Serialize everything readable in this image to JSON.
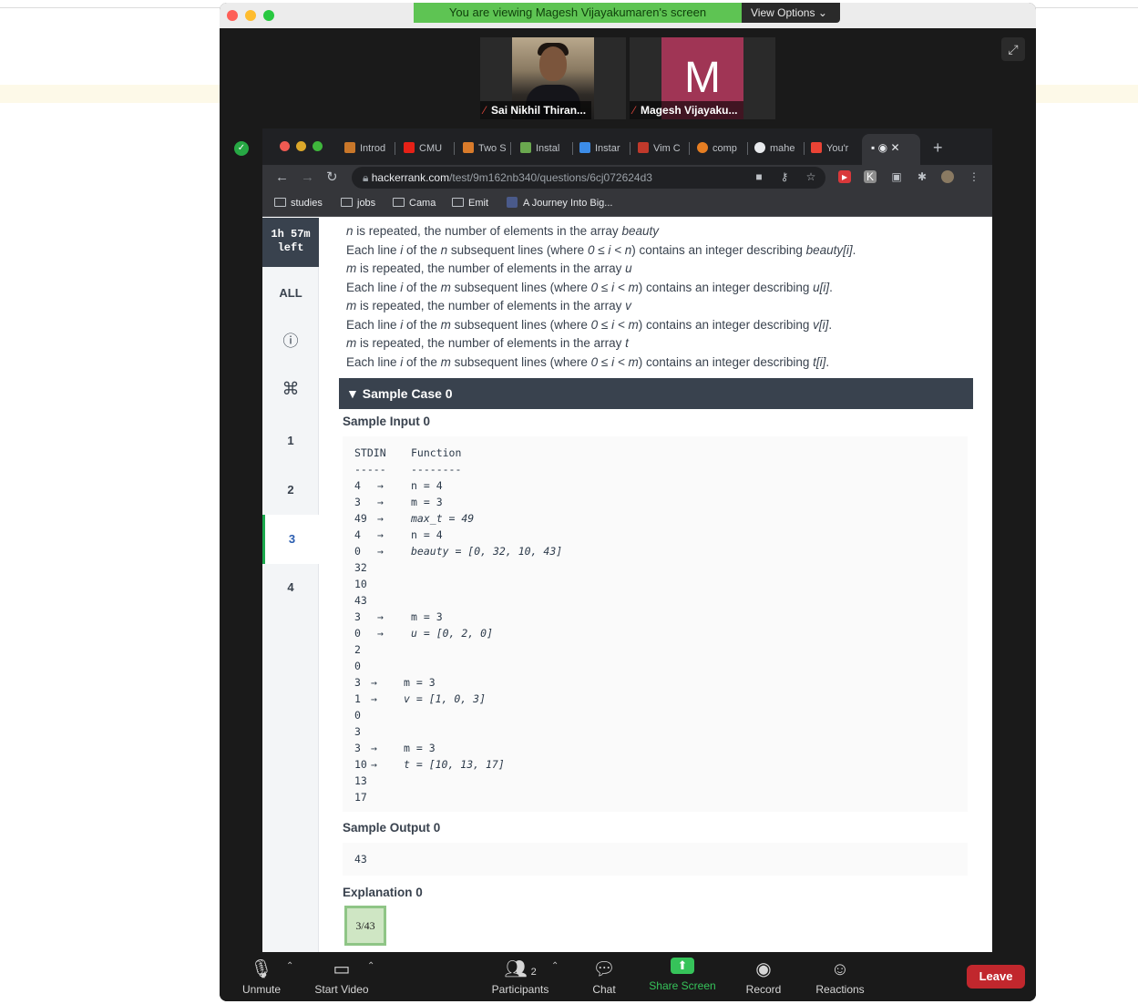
{
  "banner": {
    "viewing": "You are viewing Magesh Vijayakumaren's screen",
    "view_options": "View Options"
  },
  "participants": [
    {
      "name": "Sai Nikhil Thiran...",
      "muted": true
    },
    {
      "name": "Magesh Vijayaku...",
      "initial": "M",
      "muted": true
    }
  ],
  "browser": {
    "tabs": [
      {
        "label": "Introd"
      },
      {
        "label": "CMU"
      },
      {
        "label": "Two S"
      },
      {
        "label": "Instal"
      },
      {
        "label": "Instar"
      },
      {
        "label": "Vim C"
      },
      {
        "label": "comp"
      },
      {
        "label": "mahe"
      },
      {
        "label": "You'r"
      }
    ],
    "url_host": "hackerrank.com",
    "url_path": "/test/9m162nb340/questions/6cj072624d3",
    "bookmarks": [
      "studies",
      "jobs",
      "Cama",
      "Emit",
      "A Journey Into Big..."
    ]
  },
  "sidebar": {
    "timer_line1": "1h 57m",
    "timer_line2": "left",
    "items": [
      "ALL",
      "1",
      "2",
      "3",
      "4"
    ],
    "active": "3"
  },
  "description": [
    {
      "parts": [
        [
          "i",
          "n"
        ],
        [
          "t",
          " is repeated, the number of elements in the array "
        ],
        [
          "i",
          "beauty"
        ]
      ]
    },
    {
      "parts": [
        [
          "t",
          "Each line "
        ],
        [
          "i",
          "i"
        ],
        [
          "t",
          " of the "
        ],
        [
          "i",
          "n"
        ],
        [
          "t",
          " subsequent lines (where "
        ],
        [
          "i",
          "0 ≤ i < n"
        ],
        [
          "t",
          ") contains an integer describing "
        ],
        [
          "i",
          "beauty[i]"
        ],
        [
          "t",
          "."
        ]
      ]
    },
    {
      "parts": [
        [
          "i",
          "m"
        ],
        [
          "t",
          " is repeated, the number of elements in the array "
        ],
        [
          "i",
          "u"
        ]
      ]
    },
    {
      "parts": [
        [
          "t",
          "Each line "
        ],
        [
          "i",
          "i"
        ],
        [
          "t",
          " of the "
        ],
        [
          "i",
          "m"
        ],
        [
          "t",
          " subsequent lines (where "
        ],
        [
          "i",
          "0 ≤ i < m"
        ],
        [
          "t",
          ") contains an integer describing "
        ],
        [
          "i",
          "u[i]"
        ],
        [
          "t",
          "."
        ]
      ]
    },
    {
      "parts": [
        [
          "i",
          "m"
        ],
        [
          "t",
          " is repeated, the number of elements in the array "
        ],
        [
          "i",
          "v"
        ]
      ]
    },
    {
      "parts": [
        [
          "t",
          "Each line "
        ],
        [
          "i",
          "i"
        ],
        [
          "t",
          " of the "
        ],
        [
          "i",
          "m"
        ],
        [
          "t",
          " subsequent lines (where "
        ],
        [
          "i",
          "0 ≤ i < m"
        ],
        [
          "t",
          ") contains an integer describing "
        ],
        [
          "i",
          "v[i]"
        ],
        [
          "t",
          "."
        ]
      ]
    },
    {
      "parts": [
        [
          "i",
          "m"
        ],
        [
          "t",
          " is repeated, the number of elements in the array "
        ],
        [
          "i",
          "t"
        ]
      ]
    },
    {
      "parts": [
        [
          "t",
          "Each line "
        ],
        [
          "i",
          "i"
        ],
        [
          "t",
          " of the "
        ],
        [
          "i",
          "m"
        ],
        [
          "t",
          " subsequent lines (where "
        ],
        [
          "i",
          "0 ≤ i < m"
        ],
        [
          "t",
          ") contains an integer describing "
        ],
        [
          "i",
          "t[i]"
        ],
        [
          "t",
          "."
        ]
      ]
    }
  ],
  "sample": {
    "header": "Sample Case 0",
    "input_title": "Sample Input 0",
    "input_lines": [
      {
        "stdin": "STDIN",
        "arrow": "",
        "fn": "Function",
        "italic": false
      },
      {
        "stdin": "-----",
        "arrow": "",
        "fn": "--------",
        "italic": false
      },
      {
        "stdin": "4",
        "arrow": "→",
        "fn": "n = 4",
        "italic": false
      },
      {
        "stdin": "3",
        "arrow": "→",
        "fn": "m = 3",
        "italic": false
      },
      {
        "stdin": "49",
        "arrow": "→",
        "fn": "max_t = 49",
        "italic": true
      },
      {
        "stdin": "4",
        "arrow": "→",
        "fn": "n = 4",
        "italic": false
      },
      {
        "stdin": "0",
        "arrow": "→",
        "fn": "beauty = [0, 32, 10, 43]",
        "italic": true
      },
      {
        "stdin": "32",
        "arrow": "",
        "fn": "",
        "italic": false
      },
      {
        "stdin": "10",
        "arrow": "",
        "fn": "",
        "italic": false
      },
      {
        "stdin": "43",
        "arrow": "",
        "fn": "",
        "italic": false
      },
      {
        "stdin": "3",
        "arrow": "→",
        "fn": "m = 3",
        "italic": false
      },
      {
        "stdin": "0",
        "arrow": "→",
        "fn": "u = [0, 2, 0]",
        "italic": true
      },
      {
        "stdin": "2",
        "arrow": "",
        "fn": "",
        "italic": false
      },
      {
        "stdin": "0",
        "arrow": "",
        "fn": "",
        "italic": false
      },
      {
        "stdin": "3",
        "arrow": "→",
        "fn": "m = 3",
        "italic": false,
        "tight": true
      },
      {
        "stdin": "1",
        "arrow": "→",
        "fn": "v = [1, 0, 3]",
        "italic": true,
        "tight": true
      },
      {
        "stdin": "0",
        "arrow": "",
        "fn": "",
        "italic": false
      },
      {
        "stdin": "3",
        "arrow": "",
        "fn": "",
        "italic": false
      },
      {
        "stdin": "3",
        "arrow": "→",
        "fn": "m = 3",
        "italic": false,
        "tight": true
      },
      {
        "stdin": "10",
        "arrow": "→",
        "fn": "t = [10, 13, 17]",
        "italic": true,
        "tight": true
      },
      {
        "stdin": "13",
        "arrow": "",
        "fn": "",
        "italic": false
      },
      {
        "stdin": "17",
        "arrow": "",
        "fn": "",
        "italic": false
      }
    ],
    "output_title": "Sample Output 0",
    "output_value": "43",
    "explanation_title": "Explanation 0",
    "explanation_node": "3/43"
  },
  "controls": {
    "unmute": "Unmute",
    "start_video": "Start Video",
    "participants": "Participants",
    "participants_count": "2",
    "chat": "Chat",
    "share_screen": "Share Screen",
    "record": "Record",
    "reactions": "Reactions",
    "leave": "Leave"
  },
  "colors": {
    "share_green": "#36c35a",
    "leave_red": "#c1272d",
    "hr_dark": "#39424e",
    "banner_green": "#5ec453"
  }
}
